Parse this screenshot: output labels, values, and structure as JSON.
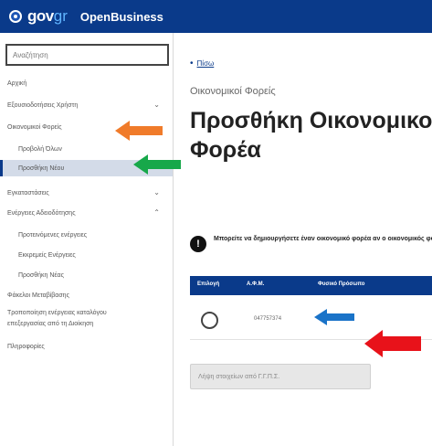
{
  "header": {
    "brand_gov": "gov",
    "brand_gr": "gr",
    "app_name": "OpenBusiness"
  },
  "sidebar": {
    "search_placeholder": "Αναζήτηση",
    "items": [
      {
        "label": "Αρχική"
      },
      {
        "label": "Εξουσιοδοτήσεις Χρήστη"
      },
      {
        "label": "Οικονομικοί Φορείς"
      },
      {
        "label": "Προβολή Όλων"
      },
      {
        "label": "Προσθήκη Νέου"
      },
      {
        "label": "Εγκαταστάσεις"
      },
      {
        "label": "Ενέργειες Αδειοδότησης"
      },
      {
        "label": "Προτεινόμενες ενέργειες"
      },
      {
        "label": "Εκκρεμείς Ενέργειες"
      },
      {
        "label": "Προσθήκη Νέας"
      },
      {
        "label": "Φάκελοι Μεταβίβασης"
      },
      {
        "label": "Τροποποίηση ενέργειας καταλόγου"
      },
      {
        "label": "επεξεργασίας από τη Διοίκηση"
      },
      {
        "label": "Πληροφορίες"
      }
    ]
  },
  "main": {
    "breadcrumb": "Πίσω",
    "section_caption": "Οικονομικοί Φορείς",
    "page_title": "Προσθήκη Οικονομικού Φορέα",
    "info_text": "Μπορείτε να δημιουργήσετε έναν οικονομικό φορέα αν ο οικονομικός φορέας.",
    "table": {
      "headers": [
        "Επιλογή",
        "Α.Φ.Μ.",
        "Φυσικό Πρόσωπο"
      ],
      "row": {
        "afm": "047757374",
        "value": "-"
      }
    },
    "taxis_button": "Λήψη στοιχείων από Γ.Γ.Π.Σ."
  },
  "annotations": {
    "orange": "#f07b2a",
    "green": "#17a84a",
    "blue": "#1a73c8",
    "red": "#e8121a"
  }
}
